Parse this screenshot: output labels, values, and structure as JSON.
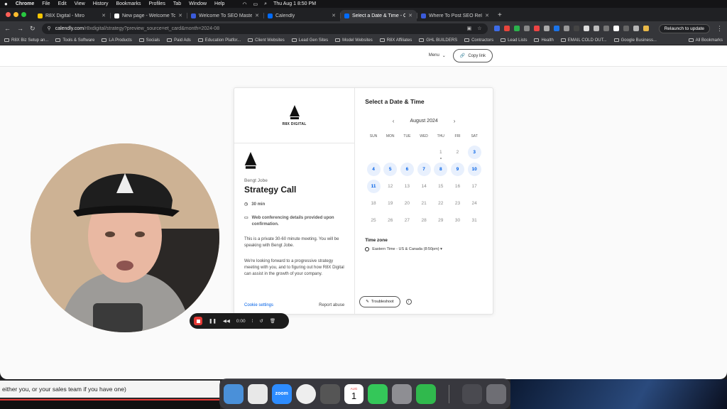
{
  "menubar": {
    "app": "Chrome",
    "items": [
      "File",
      "Edit",
      "View",
      "History",
      "Bookmarks",
      "Profiles",
      "Tab",
      "Window",
      "Help"
    ],
    "datetime": "Thu Aug 1  8:50 PM"
  },
  "tabs": [
    {
      "title": "R8X Digital - Miro",
      "color": "#f7c600"
    },
    {
      "title": "New page - Welcome To Lan",
      "color": "#ffffff"
    },
    {
      "title": "Welcome To SEO Mastery",
      "color": "#3b5bdb"
    },
    {
      "title": "Calendly",
      "color": "#006bff"
    },
    {
      "title": "Select a Date & Time - Ca",
      "color": "#006bff"
    },
    {
      "title": "Where To Post SEO Related",
      "color": "#3b5bdb"
    }
  ],
  "toolbar": {
    "url_host": "calendly.com",
    "url_rest": "/r8xdigital/strategy?preview_source=et_card&month=2024-08",
    "relaunch": "Relaunch to update"
  },
  "bookmarks": [
    "R8X Biz Setup an...",
    "Tools & Software",
    "LA Products",
    "Socials",
    "Paid Ads",
    "Education Platfor...",
    "Client Websites",
    "Lead Gen Sites",
    "Model Websites",
    "R8X Affiliates",
    "GHL BUILDERS",
    "Contractors",
    "Lead Lists",
    "Health",
    "EMAIL COLD OUT...",
    "Google Business..."
  ],
  "bookmarks_all": "All Bookmarks",
  "topnav": {
    "menu": "Menu",
    "copy_link": "Copy link"
  },
  "card": {
    "logo_text": "R8X DIGITAL",
    "host": "Bengt Jobe",
    "title": "Strategy Call",
    "duration": "30 min",
    "conferencing": "Web conferencing details provided upon confirmation.",
    "desc1": "This is a private 30-60 minute meeting. You will be speaking with Bengt Jobe.",
    "desc2": "We're looking forward to a progressive strategy meeting with you, and to figuring out how R8X Digital can assist in the growth of your company.",
    "cookie": "Cookie settings",
    "report": "Report abuse",
    "select_title": "Select a Date & Time",
    "month": "August 2024",
    "weekdays": [
      "SUN",
      "MON",
      "TUE",
      "WED",
      "THU",
      "FRI",
      "SAT"
    ],
    "days": [
      {
        "n": "",
        "a": false
      },
      {
        "n": "",
        "a": false
      },
      {
        "n": "",
        "a": false
      },
      {
        "n": "",
        "a": false
      },
      {
        "n": "1",
        "a": false,
        "today": true
      },
      {
        "n": "2",
        "a": false
      },
      {
        "n": "3",
        "a": true
      },
      {
        "n": "4",
        "a": true
      },
      {
        "n": "5",
        "a": true
      },
      {
        "n": "6",
        "a": true
      },
      {
        "n": "7",
        "a": true
      },
      {
        "n": "8",
        "a": true
      },
      {
        "n": "9",
        "a": true
      },
      {
        "n": "10",
        "a": true
      },
      {
        "n": "11",
        "a": true
      },
      {
        "n": "12",
        "a": false
      },
      {
        "n": "13",
        "a": false
      },
      {
        "n": "14",
        "a": false
      },
      {
        "n": "15",
        "a": false
      },
      {
        "n": "16",
        "a": false
      },
      {
        "n": "17",
        "a": false
      },
      {
        "n": "18",
        "a": false
      },
      {
        "n": "19",
        "a": false
      },
      {
        "n": "20",
        "a": false
      },
      {
        "n": "21",
        "a": false
      },
      {
        "n": "22",
        "a": false
      },
      {
        "n": "23",
        "a": false
      },
      {
        "n": "24",
        "a": false
      },
      {
        "n": "25",
        "a": false
      },
      {
        "n": "26",
        "a": false
      },
      {
        "n": "27",
        "a": false
      },
      {
        "n": "28",
        "a": false
      },
      {
        "n": "29",
        "a": false
      },
      {
        "n": "30",
        "a": false
      },
      {
        "n": "31",
        "a": false
      }
    ],
    "tz_label": "Time zone",
    "tz_value": "Eastern Time - US & Canada (8:50pm) ▾",
    "troubleshoot": "Troubleshoot"
  },
  "recorder": {
    "time": "0:00"
  },
  "subtitle": "either you, or your sales team if you have one)",
  "dock": {
    "zoom": "zoom",
    "calendar_month": "AUG",
    "calendar_day": "1",
    "icon_colors": [
      "#4a90d9",
      "#e8e8e8",
      "#2d8cff",
      "#eeeeee",
      "#555555",
      "#ffffff",
      "#34c759",
      "#8e8e93",
      "#30b94d"
    ]
  }
}
